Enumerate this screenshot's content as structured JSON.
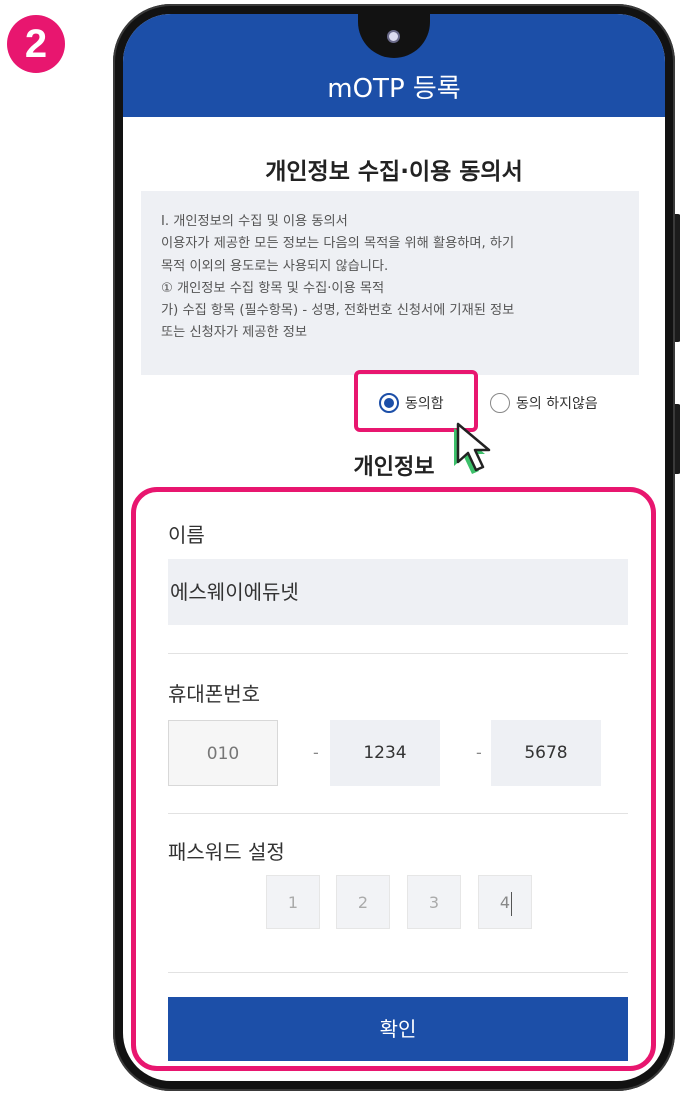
{
  "step_badge": "2",
  "header": {
    "title": "mOTP 등록"
  },
  "consent": {
    "title": "개인정보 수집·이용 동의서",
    "terms_lines": [
      "Ⅰ. 개인정보의 수집 및 이용 동의서",
      "이용자가 제공한 모든 정보는 다음의 목적을 위해 활용하며, 하기",
      "목적 이외의 용도로는 사용되지 않습니다.",
      "① 개인정보 수집 항목 및 수집·이용 목적",
      "가) 수집 항목 (필수항목) - 성명, 전화번호 신청서에 기재된 정보",
      "또는 신청자가 제공한 정보"
    ],
    "agree_label": "동의함",
    "disagree_label": "동의 하지않음",
    "selected": "agree"
  },
  "personal": {
    "section_title": "개인정보",
    "name_label": "이름",
    "name_value": "에스웨이에듀넷",
    "phone_label": "휴대폰번호",
    "phone_parts": [
      "010",
      "1234",
      "5678"
    ],
    "phone_separator": "-",
    "password_label": "패스워드 설정",
    "password_digits": [
      "1",
      "2",
      "3",
      "4"
    ]
  },
  "confirm_label": "확인",
  "colors": {
    "brand_blue": "#1c4fa8",
    "highlight_pink": "#e8166f",
    "cursor_green": "#3cc06a"
  }
}
